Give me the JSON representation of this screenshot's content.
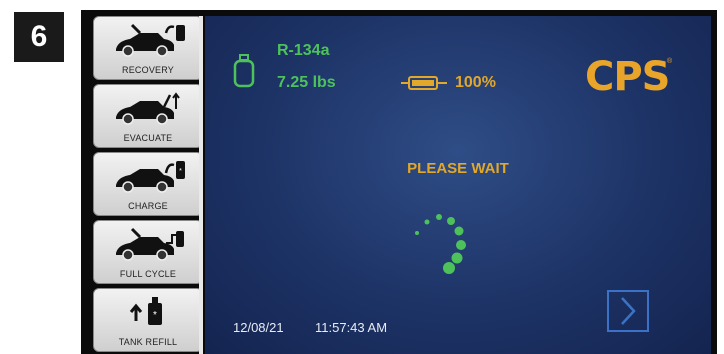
{
  "step": {
    "number": "6"
  },
  "sidebar": {
    "items": [
      {
        "label": "RECOVERY",
        "icon": "car-recovery-icon"
      },
      {
        "label": "EVACUATE",
        "icon": "car-evacuate-icon"
      },
      {
        "label": "CHARGE",
        "icon": "car-charge-icon"
      },
      {
        "label": "FULL CYCLE",
        "icon": "car-full-cycle-icon"
      },
      {
        "label": "TANK REFILL",
        "icon": "tank-refill-icon"
      }
    ]
  },
  "status_bar": {
    "refrigerant": "R-134a",
    "weight": "7.25 lbs",
    "battery_percent": "100%",
    "logo": "CPS",
    "logo_mark": "®"
  },
  "main": {
    "status": "PLEASE WAIT"
  },
  "footer": {
    "date": "12/08/21",
    "time": "11:57:43 AM",
    "next_icon": "chevron-right-icon"
  },
  "colors": {
    "accent_green": "#4dc25a",
    "accent_orange": "#e2a829",
    "screen_blue": "#1d3366",
    "button_border": "#3c72c6"
  }
}
